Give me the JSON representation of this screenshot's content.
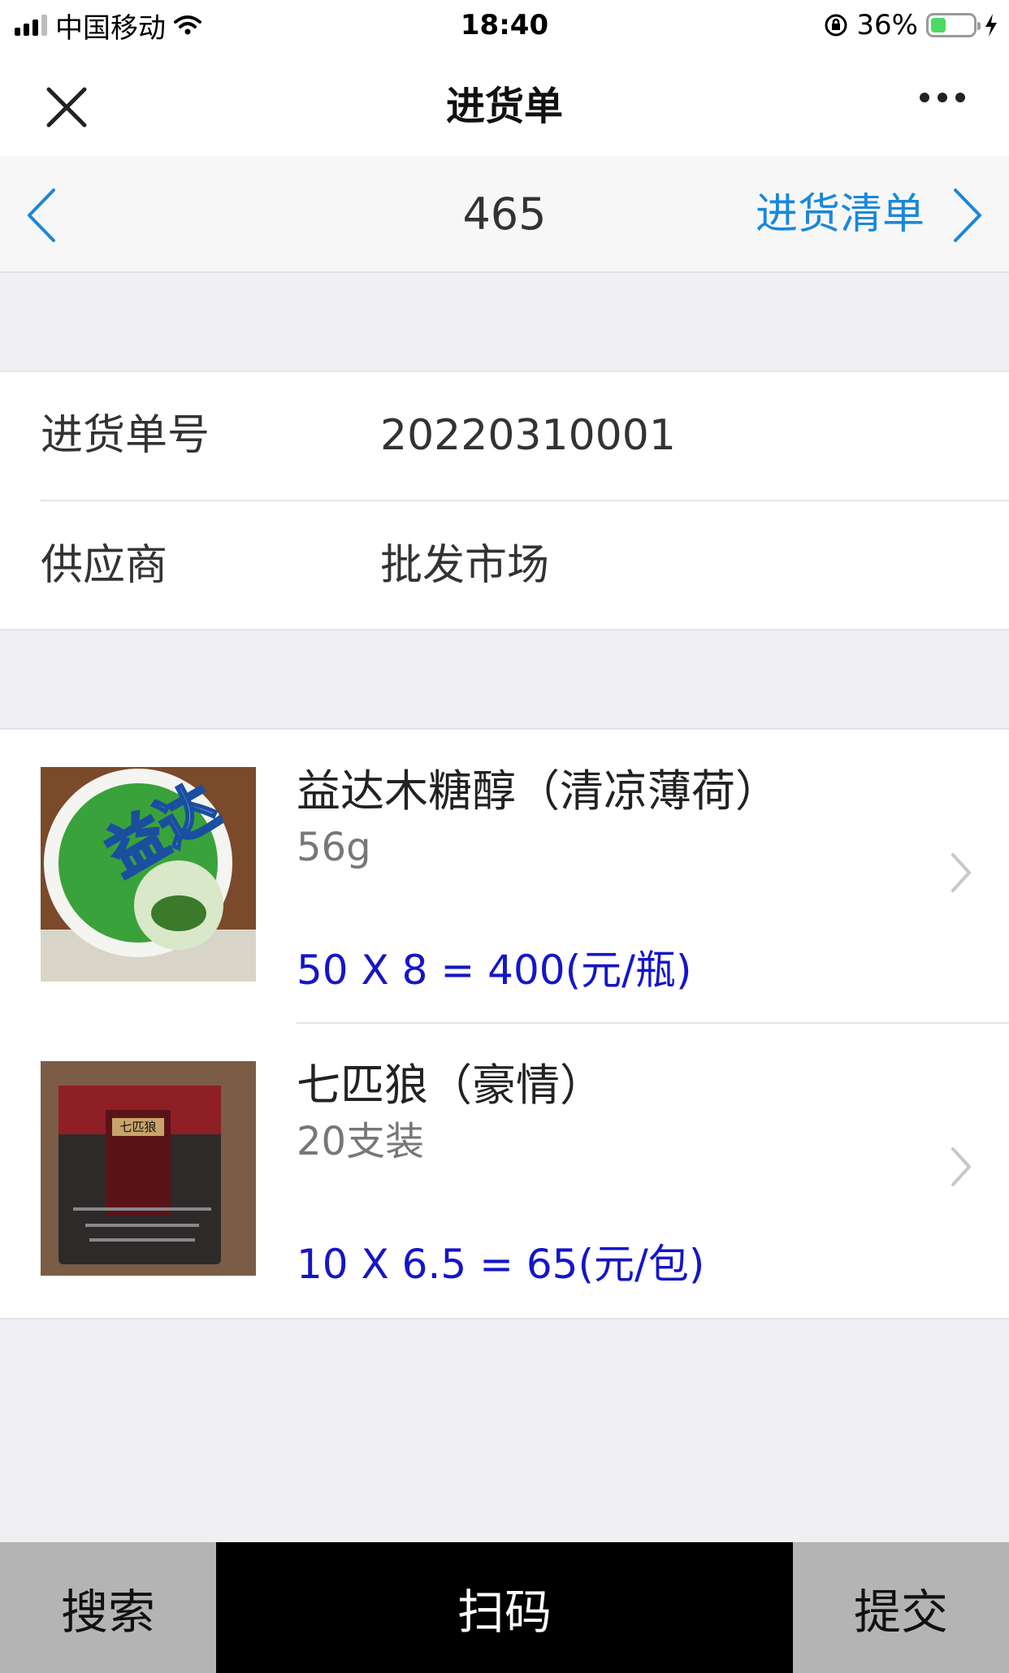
{
  "status_bar": {
    "carrier": "中国移动",
    "time": "18:40",
    "battery_percent": "36%",
    "battery_level": 0.36,
    "icons": [
      "signal-icon",
      "wifi-icon",
      "rotation-lock-icon",
      "battery-icon",
      "charging-icon"
    ]
  },
  "nav": {
    "title": "进货单",
    "close_icon": "close-icon",
    "more_icon": "more-icon"
  },
  "pager": {
    "number": "465",
    "list_label": "进货清单",
    "prev_icon": "chevron-left-icon",
    "next_icon": "chevron-right-icon"
  },
  "info": {
    "order_no_label": "进货单号",
    "order_no_value": "20220310001",
    "supplier_label": "供应商",
    "supplier_value": "批发市场"
  },
  "items": [
    {
      "name": "益达木糖醇（清凉薄荷）",
      "spec": "56g",
      "price": "50 X 8 = 400(元/瓶)",
      "thumb_text": "益达"
    },
    {
      "name": "七匹狼（豪情）",
      "spec": "20支装",
      "price": "10 X 6.5 = 65(元/包)",
      "thumb_text": "七匹狼"
    }
  ],
  "bottom": {
    "search_label": "搜索",
    "scan_label": "扫码",
    "submit_label": "提交"
  },
  "colors": {
    "accent_blue": "#1a88d8",
    "price_blue": "#1515c8",
    "background": "#efeff4",
    "scan_button_bg": "#000000",
    "side_button_bg": "#b4b4b4"
  }
}
